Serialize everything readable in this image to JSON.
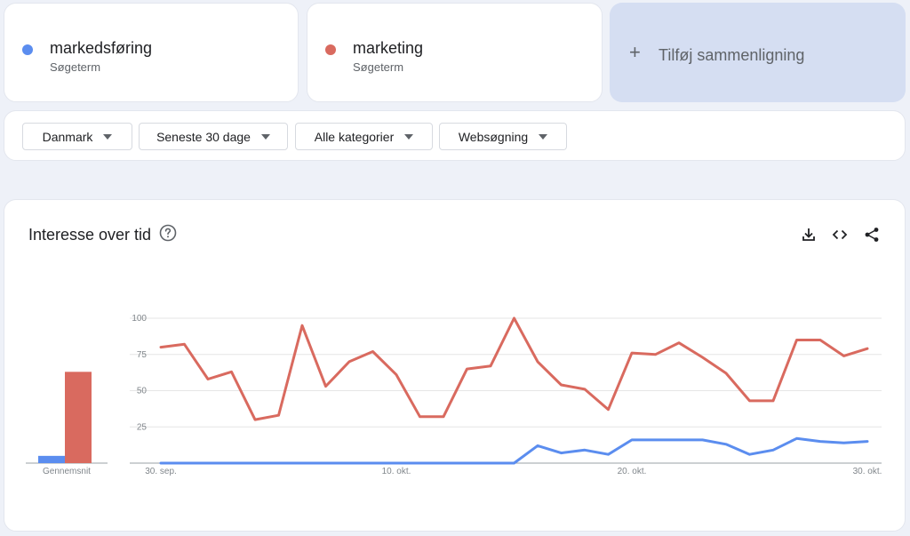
{
  "terms": [
    {
      "name": "markedsføring",
      "sub": "Søgeterm",
      "color": "#5b8def"
    },
    {
      "name": "marketing",
      "sub": "Søgeterm",
      "color": "#d96a5f"
    }
  ],
  "add_compare": {
    "plus": "+",
    "label": "Tilføj sammenligning"
  },
  "filters": {
    "region": "Danmark",
    "time": "Seneste 30 dage",
    "category": "Alle kategorier",
    "property": "Websøgning"
  },
  "chart_panel": {
    "title": "Interesse over tid"
  },
  "chart_data": {
    "type": "line",
    "ylim": [
      0,
      100
    ],
    "yticks": [
      "100",
      "75",
      "50",
      "25"
    ],
    "ytick_values": [
      100,
      75,
      50,
      25
    ],
    "xtick_labels": [
      "30. sep.",
      "10. okt.",
      "20. okt.",
      "30. okt."
    ],
    "xtick_index": [
      0,
      10,
      20,
      30
    ],
    "average_label": "Gennemsnit",
    "series": [
      {
        "name": "markedsføring",
        "color": "#5b8def",
        "average": 5,
        "values": [
          0,
          0,
          0,
          0,
          0,
          0,
          0,
          0,
          0,
          0,
          0,
          0,
          0,
          0,
          0,
          0,
          12,
          7,
          9,
          6,
          16,
          16,
          16,
          16,
          13,
          6,
          9,
          17,
          15,
          14,
          15
        ]
      },
      {
        "name": "marketing",
        "color": "#d96a5f",
        "average": 63,
        "values": [
          80,
          82,
          58,
          63,
          30,
          33,
          95,
          53,
          70,
          77,
          61,
          32,
          32,
          65,
          67,
          100,
          70,
          54,
          51,
          37,
          76,
          75,
          83,
          73,
          62,
          43,
          43,
          85,
          85,
          74,
          79
        ]
      }
    ]
  }
}
